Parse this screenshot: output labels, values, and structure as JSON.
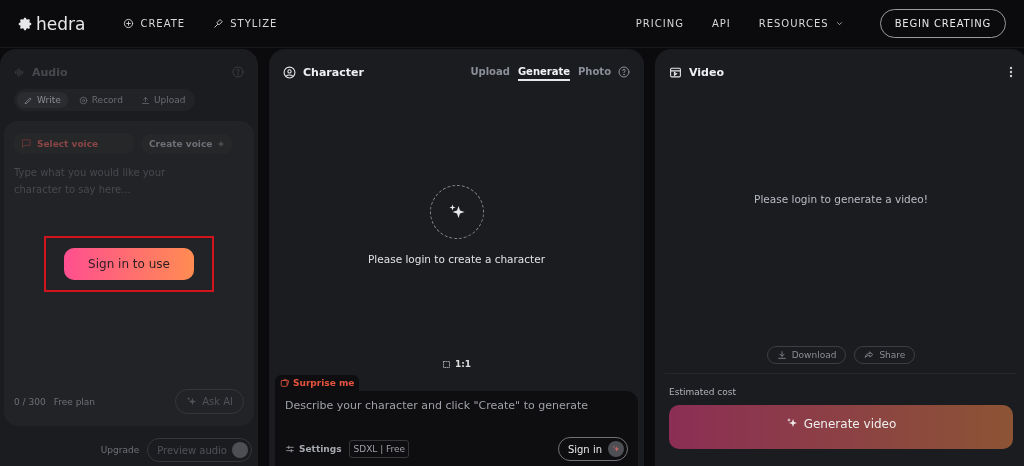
{
  "header": {
    "logo": "hedra",
    "nav": [
      {
        "label": "CREATE",
        "kind": "create"
      },
      {
        "label": "STYLIZE",
        "kind": "stylize"
      }
    ],
    "links": [
      {
        "label": "PRICING",
        "dropdown": false
      },
      {
        "label": "API",
        "dropdown": false
      },
      {
        "label": "RESOURCES",
        "dropdown": true
      }
    ],
    "cta": "BEGIN CREATING"
  },
  "audio": {
    "title": "Audio",
    "tabs": [
      {
        "label": "Write",
        "kind": "write",
        "selected": true
      },
      {
        "label": "Record",
        "kind": "record",
        "selected": false
      },
      {
        "label": "Upload",
        "kind": "upload",
        "selected": false
      }
    ],
    "voice_select": "Select voice",
    "create_voice": "Create voice",
    "placeholder": "Type what you would like your character to say here...",
    "sign_in": "Sign in to use",
    "counter": "0 / 300",
    "plan": "Free plan",
    "ask_ai": "Ask AI",
    "upgrade": "Upgrade",
    "preview": "Preview audio"
  },
  "character": {
    "title": "Character",
    "tabs": [
      {
        "label": "Upload",
        "selected": false
      },
      {
        "label": "Generate",
        "selected": true
      },
      {
        "label": "Photo",
        "selected": false
      }
    ],
    "message": "Please login to create a character",
    "aspect": "1:1",
    "surprise": "Surprise me",
    "placeholder": "Describe your character and click \"Create\" to generate",
    "settings": "Settings",
    "model": "SDXL | Free",
    "sign_in": "Sign in"
  },
  "video": {
    "title": "Video",
    "message": "Please login to generate a video!",
    "download": "Download",
    "share": "Share",
    "cost_label": "Estimated cost",
    "generate": "Generate video"
  }
}
